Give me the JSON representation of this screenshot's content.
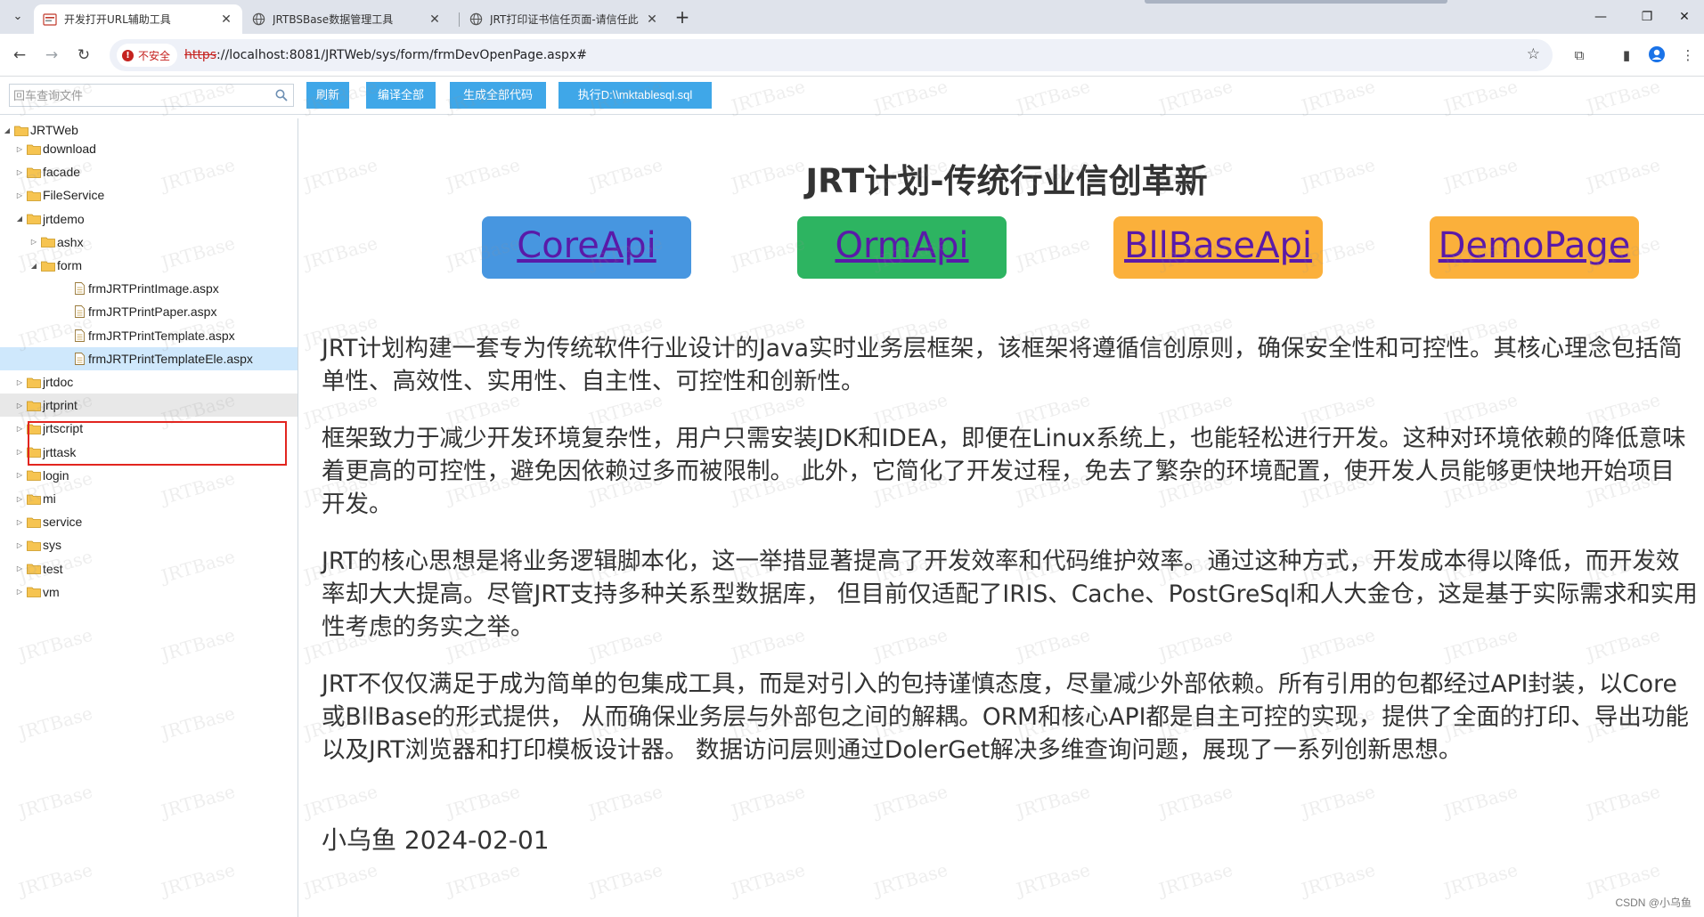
{
  "browser": {
    "tabs": [
      {
        "title": "开发打开URL辅助工具",
        "active": true,
        "close": "✕"
      },
      {
        "title": "JRTBSBase数据管理工具",
        "active": false,
        "close": "✕"
      },
      {
        "title": "JRT打印证书信任页面-请信任此",
        "active": false,
        "close": "✕"
      }
    ],
    "new_tab": "+",
    "window_controls": {
      "minimize": "—",
      "restore": "❐",
      "close": "✕"
    },
    "security_label": "不安全",
    "url_scheme": "https",
    "url_rest": "://localhost:8081/JRTWeb/sys/form/frmDevOpenPage.aspx#"
  },
  "toolbar": {
    "search_placeholder": "回车查询文件",
    "buttons": [
      "刷新",
      "编译全部",
      "生成全部代码",
      "执行D:\\\\mktablesql.sql"
    ]
  },
  "tree": {
    "root": "JRTWeb",
    "items": [
      {
        "label": "download",
        "type": "folder",
        "depth": 1,
        "expanded": false
      },
      {
        "label": "facade",
        "type": "folder",
        "depth": 1,
        "expanded": false
      },
      {
        "label": "FileService",
        "type": "folder",
        "depth": 1,
        "expanded": false
      },
      {
        "label": "jrtdemo",
        "type": "folder",
        "depth": 1,
        "expanded": true
      },
      {
        "label": "ashx",
        "type": "folder",
        "depth": 2,
        "expanded": false
      },
      {
        "label": "form",
        "type": "folder",
        "depth": 2,
        "expanded": true
      },
      {
        "label": "frmJRTPrintImage.aspx",
        "type": "file",
        "depth": 3
      },
      {
        "label": "frmJRTPrintPaper.aspx",
        "type": "file",
        "depth": 3
      },
      {
        "label": "frmJRTPrintTemplate.aspx",
        "type": "file",
        "depth": 3
      },
      {
        "label": "frmJRTPrintTemplateEle.aspx",
        "type": "file",
        "depth": 3,
        "selected": true
      },
      {
        "label": "jrtdoc",
        "type": "folder",
        "depth": 1,
        "expanded": false
      },
      {
        "label": "jrtprint",
        "type": "folder",
        "depth": 1,
        "expanded": false,
        "hover": true
      },
      {
        "label": "jrtscript",
        "type": "folder",
        "depth": 1,
        "expanded": false
      },
      {
        "label": "jrttask",
        "type": "folder",
        "depth": 1,
        "expanded": false
      },
      {
        "label": "login",
        "type": "folder",
        "depth": 1,
        "expanded": false
      },
      {
        "label": "mi",
        "type": "folder",
        "depth": 1,
        "expanded": false
      },
      {
        "label": "service",
        "type": "folder",
        "depth": 1,
        "expanded": false
      },
      {
        "label": "sys",
        "type": "folder",
        "depth": 1,
        "expanded": false
      },
      {
        "label": "test",
        "type": "folder",
        "depth": 1,
        "expanded": false
      },
      {
        "label": "vm",
        "type": "folder",
        "depth": 1,
        "expanded": false
      }
    ]
  },
  "content": {
    "title": "JRT计划-传统行业信创革新",
    "links": [
      {
        "label": "CoreApi",
        "color": "#4796e0"
      },
      {
        "label": "OrmApi",
        "color": "#2db461"
      },
      {
        "label": "BllBaseApi",
        "color": "#fbb03b"
      },
      {
        "label": "DemoPage",
        "color": "#fbb03b"
      }
    ],
    "paragraphs": [
      "JRT计划构建一套专为传统软件行业设计的Java实时业务层框架，该框架将遵循信创原则，确保安全性和可控性。其核心理念包括简单性、高效性、实用性、自主性、可控性和创新性。",
      "框架致力于减少开发环境复杂性，用户只需安装JDK和IDEA，即便在Linux系统上，也能轻松进行开发。这种对环境依赖的降低意味着更高的可控性，避免因依赖过多而被限制。 此外，它简化了开发过程，免去了繁杂的环境配置，使开发人员能够更快地开始项目开发。",
      "JRT的核心思想是将业务逻辑脚本化，这一举措显著提高了开发效率和代码维护效率。通过这种方式，开发成本得以降低，而开发效率却大大提高。尽管JRT支持多种关系型数据库， 但目前仅适配了IRIS、Cache、PostGreSql和人大金仓，这是基于实际需求和实用性考虑的务实之举。",
      "JRT不仅仅满足于成为简单的包集成工具，而是对引入的包持谨慎态度，尽量减少外部依赖。所有引用的包都经过API封装，以Core或BllBase的形式提供， 从而确保业务层与外部包之间的解耦。ORM和核心API都是自主可控的实现，提供了全面的打印、导出功能以及JRT浏览器和打印模板设计器。 数据访问层则通过DolerGet解决多维查询问题，展现了一系列创新思想。"
    ],
    "signature": "小乌鱼 2024-02-01"
  },
  "watermark_text": "JRTBase",
  "credit": "CSDN @小乌鱼"
}
